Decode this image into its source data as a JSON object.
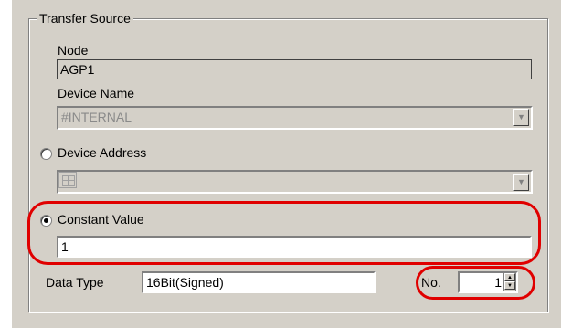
{
  "transfer_source": {
    "group_title": "Transfer Source",
    "node_label": "Node",
    "node_value": "AGP1",
    "device_name_label": "Device Name",
    "device_name_value": "#INTERNAL",
    "device_address_label": "Device Address",
    "device_address_value": "",
    "device_address_selected": false,
    "constant_value_label": "Constant Value",
    "constant_value": "1",
    "constant_value_selected": true,
    "data_type_label": "Data Type",
    "data_type_value": "16Bit(Signed)",
    "no_label": "No.",
    "no_value": "1"
  },
  "icons": {
    "dropdown": "▼",
    "spin_up": "▲",
    "spin_down": "▼"
  },
  "colors": {
    "dialog_bg": "#d4d0c8",
    "callout": "#e00000"
  }
}
